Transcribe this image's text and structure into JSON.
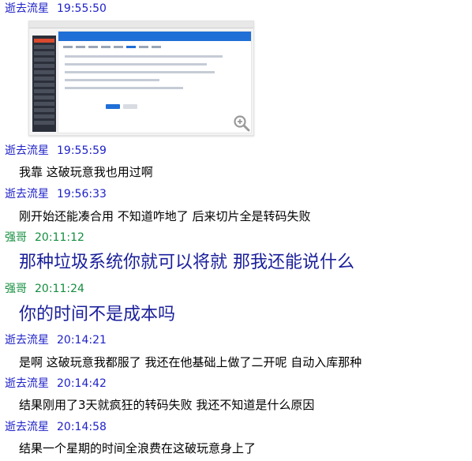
{
  "messages": [
    {
      "sender": "逝去流星",
      "time": "19:55:50",
      "text": ""
    },
    {
      "sender": "逝去流星",
      "time": "19:55:59",
      "text": "我靠 这破玩意我也用过啊"
    },
    {
      "sender": "逝去流星",
      "time": "19:56:33",
      "text": "刚开始还能凑合用 不知道咋地了 后来切片全是转码失败"
    },
    {
      "sender": "强哥",
      "time": "20:11:12",
      "text": "那种垃圾系统你就可以将就  那我还能说什么"
    },
    {
      "sender": "强哥",
      "time": "20:11:24",
      "text": "你的时间不是成本吗"
    },
    {
      "sender": "逝去流星",
      "time": "20:14:21",
      "text": "是啊 这破玩意我都服了 我还在他基础上做了二开呢 自动入库那种"
    },
    {
      "sender": "逝去流星",
      "time": "20:14:42",
      "text": "结果刚用了3天就疯狂的转码失败 我还不知道是什么原因"
    },
    {
      "sender": "逝去流星",
      "time": "20:14:58",
      "text": "结果一个星期的时间全浪费在这破玩意身上了"
    }
  ],
  "colors": {
    "sender_blue": "#1f22c8",
    "sender_green": "#138e3e",
    "big_text": "#1a1f9a"
  },
  "icons": {
    "zoom": "zoom-in-icon"
  }
}
